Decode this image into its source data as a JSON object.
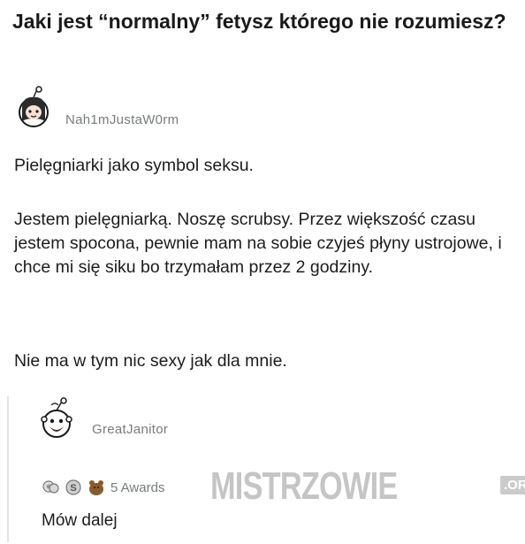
{
  "title": "Jaki jest “normalny” fetysz którego nie rozumiesz?",
  "post": {
    "username": "Nah1mJustaW0rm",
    "paragraphs": [
      "Pielęgniarki jako symbol seksu.",
      "Jestem pielęgniarką. Noszę scrubsy. Przez większość czasu jestem spocona, pewnie mam na sobie czyjeś płyny ustrojowe, i chce mi się siku bo trzymałam przez 2 godziny.",
      "Nie ma w tym nic sexy jak dla mnie."
    ]
  },
  "reply": {
    "username": "GreatJanitor",
    "awards_label": "5 Awards",
    "text": "Mów dalej"
  },
  "watermark": {
    "text": "MISTRZOWIE",
    "suffix": ".ORG"
  }
}
